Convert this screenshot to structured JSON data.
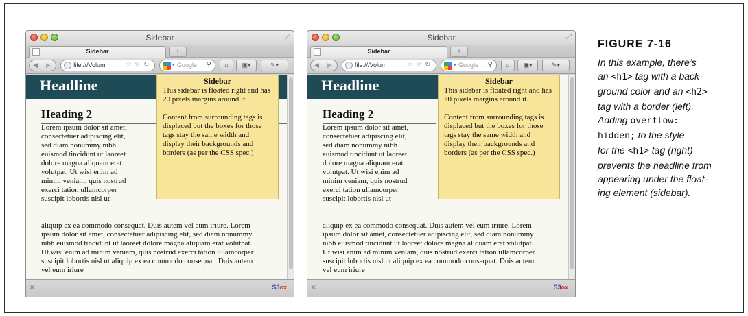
{
  "window": {
    "title": "Sidebar",
    "tab_label": "Sidebar",
    "new_tab_label": "+",
    "url": "file:///Volum",
    "search_placeholder": "Google",
    "addon_badge": "S3",
    "addon_badge_suffix": "ox"
  },
  "page": {
    "headline": "Headline",
    "heading2": "Heading 2",
    "sidebar": {
      "title": "Sidebar",
      "p1": "This sidebar is floated right and has 20 pixels margins around it.",
      "p2": "Content from surrounding tags is displaced but the boxes for those tags stay the same width and display their backgrounds and borders (as per the CSS spec.)"
    },
    "body_narrow_lines": [
      "Lorem ipsum dolor sit amet,",
      "consectetuer adipiscing elit,",
      "sed diam nonummy nibh",
      "euismod tincidunt ut laoreet",
      "dolore magna aliquam erat",
      "volutpat. Ut wisi enim ad",
      "minim veniam, quis nostrud",
      "exerci tation ullamcorper",
      "suscipit lobortis nisl ut"
    ],
    "body_wide_lines": [
      "aliquip ex ea commodo consequat. Duis autem vel eum iriure. Lorem",
      "ipsum dolor sit amet, consectetuer adipiscing elit, sed diam nonummy",
      "nibh euismod tincidunt ut laoreet dolore magna aliquam erat volutpat.",
      "Ut wisi enim ad minim veniam, quis nostrud exerci tation ullamcorper",
      "suscipit lobortis nisl ut aliquip ex ea commodo consequat. Duis autem",
      "vel eum iriure"
    ]
  },
  "caption": {
    "label": "FIGURE 7-16",
    "l1": "In this example, there’s",
    "l2a": "an ",
    "l2b": "<h1>",
    "l2c": " tag with a back-",
    "l3a": "ground color and an ",
    "l3b": "<h2>",
    "l4": "tag with a border (left).",
    "l5a": "Adding ",
    "l5b": "overflow:",
    "l6a": "hidden;",
    "l6b": " to the style",
    "l7a": "for the ",
    "l7b": "<h1>",
    "l7c": " tag (right)",
    "l8": "prevents the headline from",
    "l9": "appearing under the float-",
    "l10": "ing element (sidebar)."
  }
}
